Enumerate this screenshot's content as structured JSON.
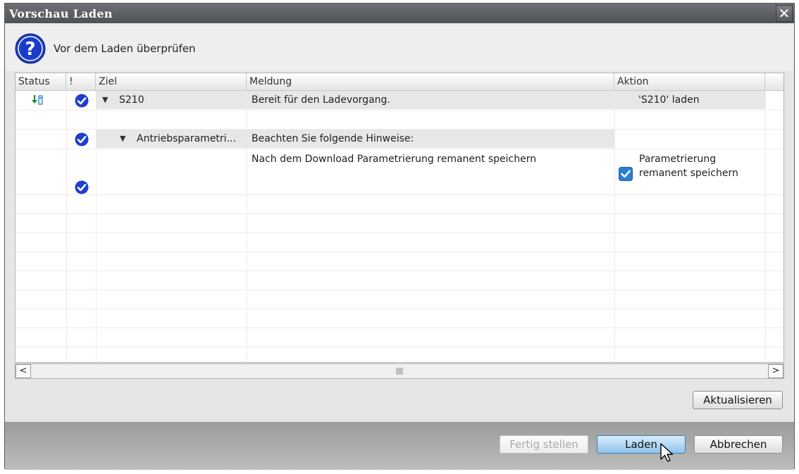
{
  "window": {
    "title": "Vorschau Laden"
  },
  "header": {
    "text": "Vor dem Laden überprüfen"
  },
  "columns": {
    "status": "Status",
    "excl": "!",
    "ziel": "Ziel",
    "meldung": "Meldung",
    "aktion": "Aktion"
  },
  "rows": [
    {
      "ziel": "S210",
      "meldung": "Bereit für den Ladevorgang.",
      "aktion": "'S210' laden"
    },
    {
      "ziel": "Antriebsparametri...",
      "meldung": "Beachten Sie folgende Hinweise:"
    },
    {
      "meldung": "Nach dem Download Parametrierung remanent speichern",
      "aktion_line1": "Parametrierung",
      "aktion_line2": "remanent speichern",
      "checked": true
    }
  ],
  "buttons": {
    "refresh": "Aktualisieren",
    "finish": "Fertig stellen",
    "load": "Laden",
    "cancel": "Abbrechen"
  },
  "colors": {
    "accent": "#1a3cc8",
    "titlebar": "#5a5e62",
    "checkbox": "#2a7fd4"
  },
  "icons": [
    "question-icon",
    "download-status-icon",
    "check-icon",
    "expand-triangle-icon",
    "checkbox-icon",
    "close-icon",
    "mouse-cursor-icon"
  ]
}
